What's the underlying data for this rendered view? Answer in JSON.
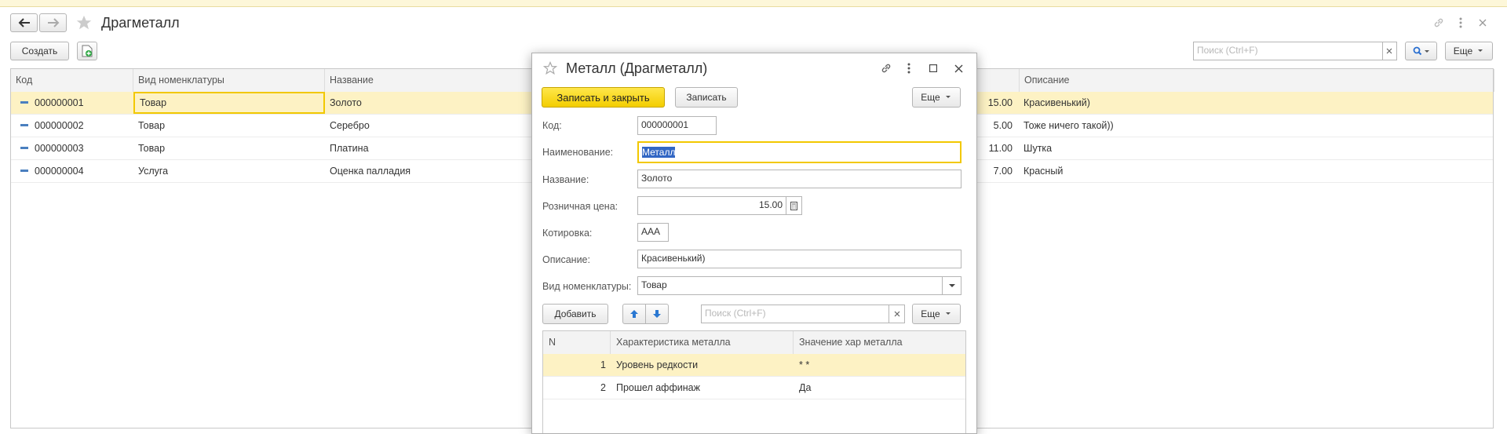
{
  "window": {
    "title": "Драгметалл",
    "create_label": "Создать",
    "search_placeholder": "Поиск (Ctrl+F)",
    "more_label": "Еще"
  },
  "list": {
    "columns": [
      "Код",
      "Вид номенклатуры",
      "Название",
      "Описание"
    ],
    "rows": [
      {
        "code": "000000001",
        "kind": "Товар",
        "name": "Золото",
        "price": "15.00",
        "desc": "Красивенький)"
      },
      {
        "code": "000000002",
        "kind": "Товар",
        "name": "Серебро",
        "price": "5.00",
        "desc": "Тоже ничего такой))"
      },
      {
        "code": "000000003",
        "kind": "Товар",
        "name": "Платина",
        "price": "11.00",
        "desc": "Шутка"
      },
      {
        "code": "000000004",
        "kind": "Услуга",
        "name": "Оценка палладия",
        "price": "7.00",
        "desc": "Красный"
      }
    ]
  },
  "dialog": {
    "title": "Металл (Драгметалл)",
    "save_close_label": "Записать и закрыть",
    "save_label": "Записать",
    "more_label": "Еще",
    "fields": {
      "code_label": "Код:",
      "code_value": "000000001",
      "naim_label": "Наименование:",
      "naim_value": "Металл",
      "name_label": "Название:",
      "name_value": "Золото",
      "price_label": "Розничная цена:",
      "price_value": "15.00",
      "quote_label": "Котировка:",
      "quote_value": "AAA",
      "desc_label": "Описание:",
      "desc_value": "Красивенький)",
      "kind_label": "Вид номенклатуры:",
      "kind_value": "Товар"
    },
    "table_toolbar": {
      "add_label": "Добавить",
      "search_placeholder": "Поиск (Ctrl+F)",
      "more_label": "Еще"
    },
    "table": {
      "columns": [
        "N",
        "Характеристика металла",
        "Значение хар металла"
      ],
      "rows": [
        {
          "n": "1",
          "char": "Уровень редкости",
          "value": "* *"
        },
        {
          "n": "2",
          "char": "Прошел аффинаж",
          "value": "Да"
        }
      ]
    }
  },
  "colors": {
    "accent_yellow": "#f3cd00",
    "selection": "#fdf2c4",
    "link_blue": "#4a7fbf"
  }
}
